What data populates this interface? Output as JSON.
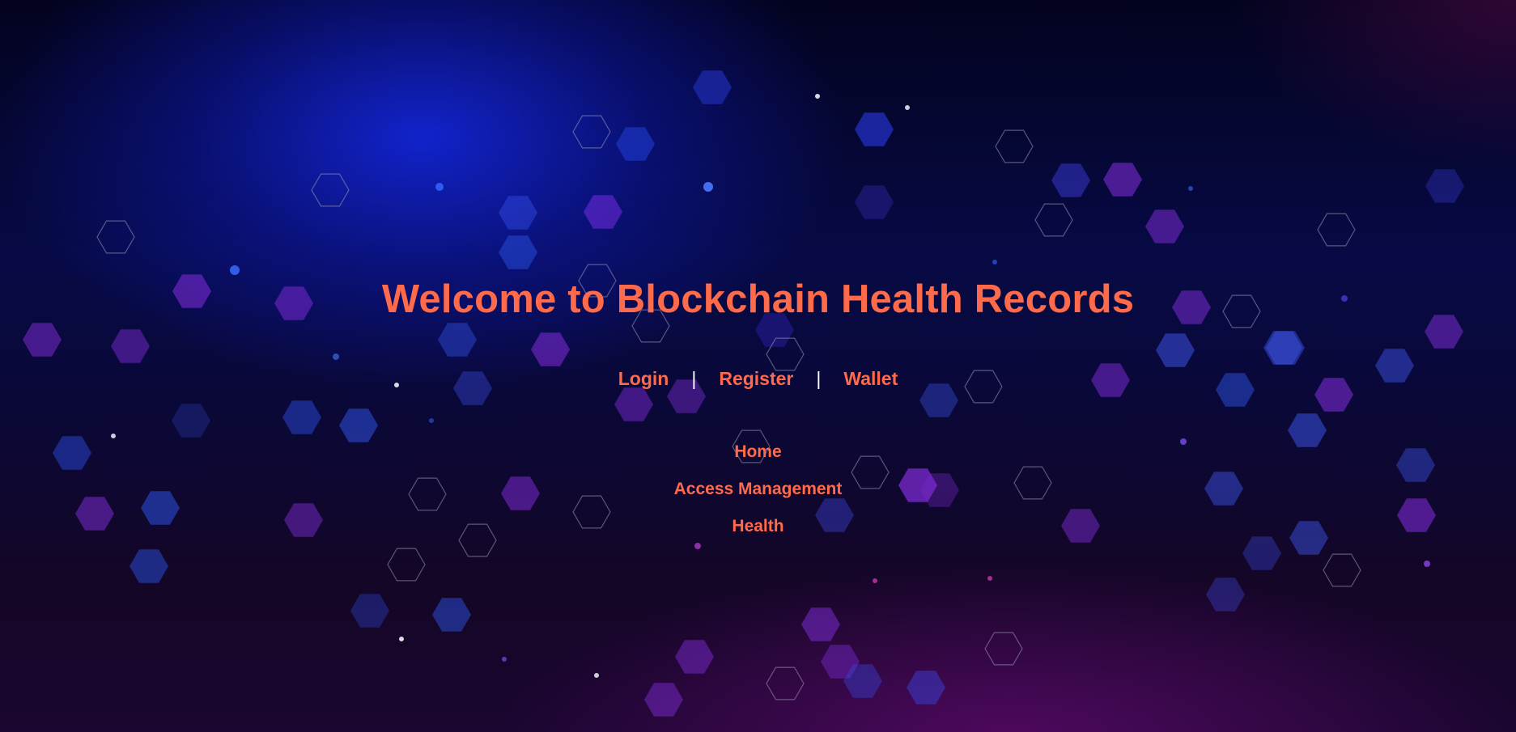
{
  "page": {
    "title": "Welcome to Blockchain Health Records"
  },
  "auth_nav": {
    "login": "Login",
    "register": "Register",
    "wallet": "Wallet",
    "separator": "|"
  },
  "main_nav": {
    "home": "Home",
    "access_management": "Access Management",
    "health": "Health"
  },
  "colors": {
    "accent": "#ff6a4a",
    "separator": "#ffffff",
    "background_top": "#070a45",
    "background_bottom": "#1a0630"
  }
}
